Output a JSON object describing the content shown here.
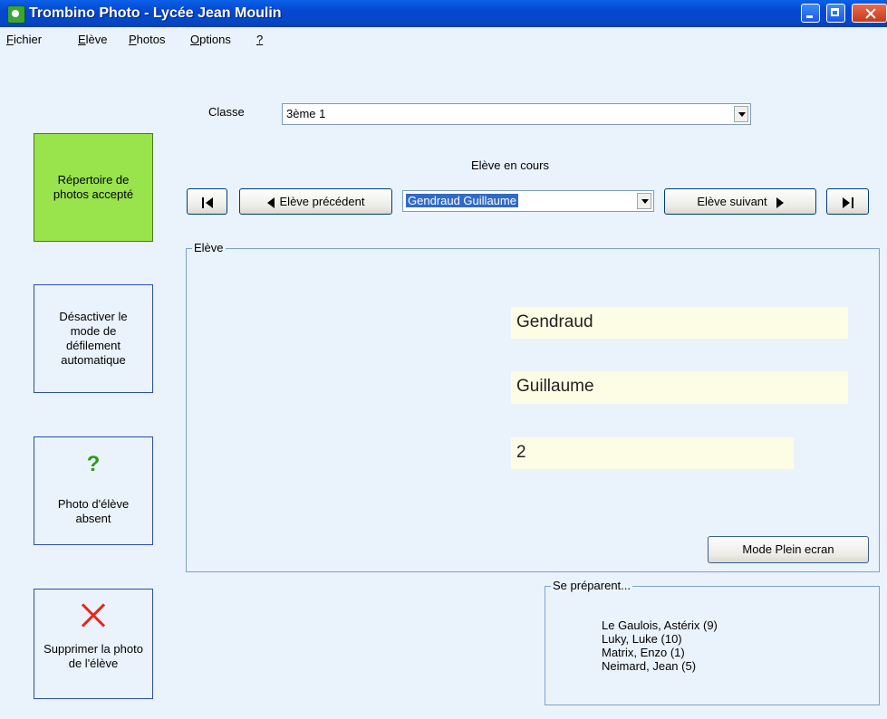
{
  "window": {
    "title": "Trombino Photo - Lycée Jean Moulin"
  },
  "menu": [
    {
      "u": "F",
      "rest": "ichier"
    },
    {
      "u": "E",
      "rest": "lève"
    },
    {
      "u": "P",
      "rest": "hotos"
    },
    {
      "u": "O",
      "rest": "ptions"
    },
    {
      "u": "?",
      "rest": ""
    }
  ],
  "classe": {
    "label": "Classe",
    "value": "3ème 1"
  },
  "navigation": {
    "label": "Elève en cours",
    "prev_label": "Elève précédent",
    "next_label": "Elève suivant",
    "current_student": "Gendraud Guillaume"
  },
  "sidebar": {
    "repertoire": "Répertoire de photos accepté",
    "defilement": "Désactiver le mode de défilement automatique",
    "absent": "Photo d'élève absent",
    "supprimer": "Supprimer la photo de l'élève",
    "accent_color": "#99e34d"
  },
  "eleve": {
    "group_title": "Elève",
    "nom": "Gendraud",
    "prenom": "Guillaume",
    "numero": "2",
    "fullscreen_label": "Mode Plein ecran"
  },
  "preparing": {
    "title": "Se préparent...",
    "items": [
      "Le Gaulois, Astérix (9)",
      "Luky, Luke (10)",
      "Matrix, Enzo (1)",
      "Neimard, Jean (5)"
    ]
  }
}
